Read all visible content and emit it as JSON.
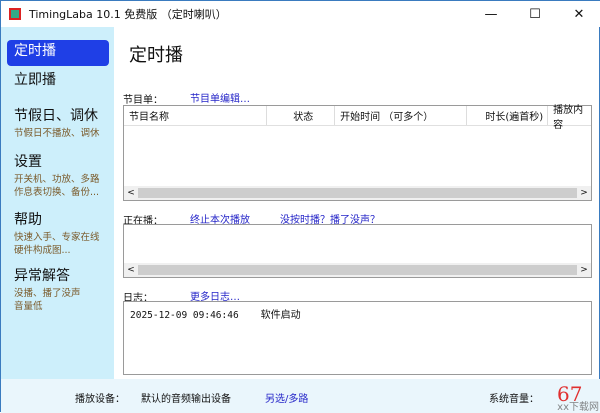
{
  "window": {
    "title": "TimingLaba 10.1 免费版 （定时喇叭）",
    "minimize": "—",
    "maximize": "☐",
    "close": "✕"
  },
  "sidebar": [
    {
      "title": "定时播",
      "sub": []
    },
    {
      "title": "立即播",
      "sub": []
    },
    {
      "title": "节假日、调休",
      "sub": [
        "节假日不播放、调休"
      ]
    },
    {
      "title": "设置",
      "sub": [
        "开关机、功放、多路",
        "作息表切换、备份..."
      ]
    },
    {
      "title": "帮助",
      "sub": [
        "快速入手、专家在线",
        "硬件构成图..."
      ]
    },
    {
      "title": "异常解答",
      "sub": [
        "没播、播了没声",
        "音量低"
      ]
    }
  ],
  "main": {
    "title": "定时播",
    "program_label": "节目单：",
    "program_edit": "节目单编辑…",
    "columns": [
      "节目名称",
      "状态",
      "开始时间 （可多个）",
      "时长(遍首秒)",
      "播放内容"
    ],
    "playing_label": "正在播：",
    "stop_link": "终止本次播放",
    "no_play_link": "没按时播？播了没声？",
    "log_label": "日志：",
    "more_log": "更多日志…",
    "log": [
      {
        "time": "2025-12-09 09:46:46",
        "msg": "软件启动"
      }
    ]
  },
  "bottom": {
    "device_label": "播放设备：",
    "device": "默认的音频输出设备",
    "device_link": "另选/多路",
    "volume_label": "系统音量：",
    "volume": "67"
  },
  "watermark": "xx下载网"
}
